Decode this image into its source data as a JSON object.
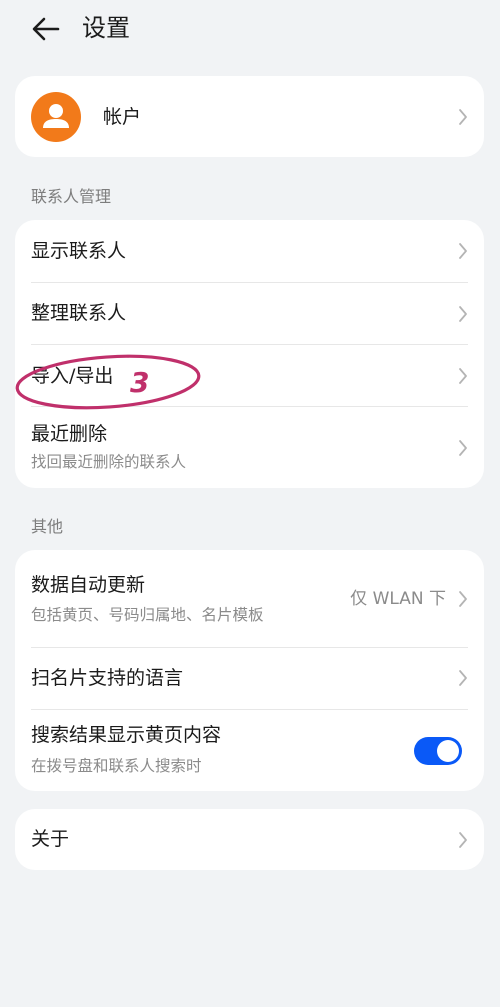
{
  "header": {
    "title": "设置"
  },
  "account": {
    "label": "帐户"
  },
  "contacts_section": {
    "label": "联系人管理",
    "items": [
      {
        "label": "显示联系人"
      },
      {
        "label": "整理联系人"
      },
      {
        "label": "导入/导出"
      },
      {
        "label": "最近删除",
        "sub": "找回最近删除的联系人"
      }
    ]
  },
  "other_section": {
    "label": "其他",
    "items": [
      {
        "label": "数据自动更新",
        "sub": "包括黄页、号码归属地、名片模板",
        "value": "仅 WLAN 下"
      },
      {
        "label": "扫名片支持的语言"
      },
      {
        "label": "搜索结果显示黄页内容",
        "sub": "在拨号盘和联系人搜索时",
        "toggle_on": true
      }
    ]
  },
  "about": {
    "label": "关于"
  },
  "annotation": {
    "number": "3",
    "color": "#c0306b"
  },
  "colors": {
    "accent": "#0a59f7",
    "avatar": "#f27a1a",
    "background": "#f1f3f5"
  }
}
